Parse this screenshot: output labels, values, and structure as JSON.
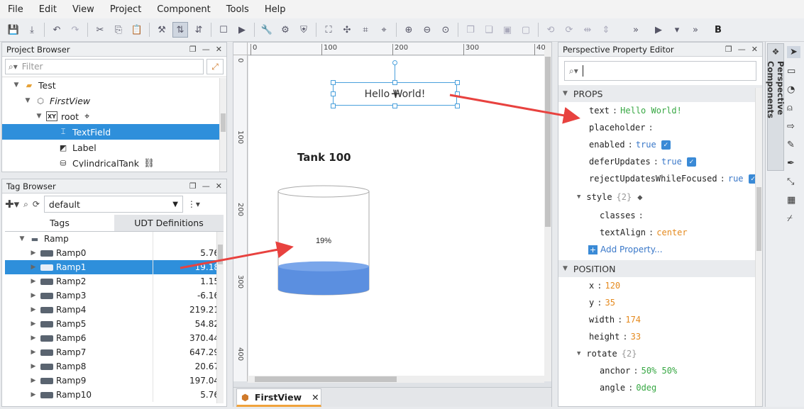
{
  "menu": [
    "File",
    "Edit",
    "View",
    "Project",
    "Component",
    "Tools",
    "Help"
  ],
  "project_browser": {
    "title": "Project Browser",
    "filter_placeholder": "Filter",
    "tree": [
      {
        "label": "Test",
        "indent": 1,
        "tri": "▼",
        "icon": "folder"
      },
      {
        "label": "FirstView",
        "indent": 2,
        "tri": "▼",
        "icon": "view",
        "italic": true
      },
      {
        "label": "root",
        "indent": 3,
        "tri": "▼",
        "icon": "xy",
        "badge": "XY"
      },
      {
        "label": "TextField",
        "indent": 4,
        "tri": "",
        "icon": "textfield",
        "selected": true
      },
      {
        "label": "Label",
        "indent": 4,
        "tri": "",
        "icon": "label"
      },
      {
        "label": "CylindricalTank",
        "indent": 4,
        "tri": "",
        "icon": "tank"
      }
    ]
  },
  "tag_browser": {
    "title": "Tag Browser",
    "provider": "default",
    "tabs": [
      "Tags",
      "UDT Definitions"
    ],
    "folder": "Ramp",
    "rows": [
      {
        "name": "Ramp0",
        "value": "5.76"
      },
      {
        "name": "Ramp1",
        "value": "19.18",
        "selected": true
      },
      {
        "name": "Ramp2",
        "value": "1.15"
      },
      {
        "name": "Ramp3",
        "value": "-6.16"
      },
      {
        "name": "Ramp4",
        "value": "219.21"
      },
      {
        "name": "Ramp5",
        "value": "54.82"
      },
      {
        "name": "Ramp6",
        "value": "370.44"
      },
      {
        "name": "Ramp7",
        "value": "647.29"
      },
      {
        "name": "Ramp8",
        "value": "20.67"
      },
      {
        "name": "Ramp9",
        "value": "197.04"
      },
      {
        "name": "Ramp10",
        "value": "5.76"
      }
    ]
  },
  "designer": {
    "ruler_h": [
      "0",
      "100",
      "200",
      "300",
      "40"
    ],
    "ruler_v": [
      "0",
      "100",
      "200",
      "300",
      "400"
    ],
    "textfield_text": "Hello World!",
    "label_text": "Tank 100",
    "tank_value": "19%",
    "tab_label": "FirstView",
    "tank_fill_percent": 19
  },
  "property_editor": {
    "title": "Perspective Property Editor",
    "props_header": "PROPS",
    "props": {
      "text_key": "text",
      "text_val": "Hello World!",
      "placeholder_key": "placeholder",
      "enabled_key": "enabled",
      "enabled_val": "true",
      "defer_key": "deferUpdates",
      "defer_val": "true",
      "reject_key": "rejectUpdatesWhileFocused",
      "reject_val": "rue",
      "style_key": "style",
      "style_count": "{2}",
      "classes_key": "classes",
      "textalign_key": "textAlign",
      "textalign_val": "center",
      "add_property": "Add Property..."
    },
    "position_header": "POSITION",
    "position": {
      "x_key": "x",
      "x_val": "120",
      "y_key": "y",
      "y_val": "35",
      "width_key": "width",
      "width_val": "174",
      "height_key": "height",
      "height_val": "33",
      "rotate_key": "rotate",
      "rotate_count": "{2}",
      "anchor_key": "anchor",
      "anchor_val": "50% 50%",
      "angle_key": "angle",
      "angle_val": "0deg"
    }
  },
  "right_dock": {
    "label": "Perspective Components"
  },
  "colors": {
    "selection": "#2e8fdb",
    "tank_fill": "#5b8fe0",
    "arrow": "#e8423f"
  }
}
